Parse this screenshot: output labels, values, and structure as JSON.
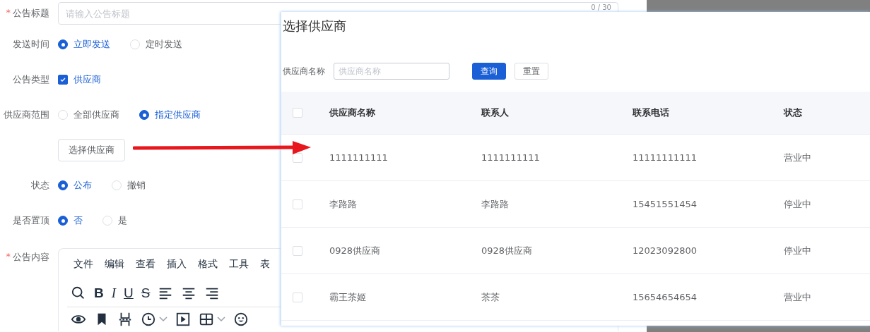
{
  "form": {
    "title_field": {
      "label": "公告标题",
      "required_mark": "*",
      "placeholder": "请输入公告标题",
      "counter": "0 / 30"
    },
    "send_time": {
      "label": "发送时间",
      "options": [
        {
          "label": "立即发送",
          "selected": true
        },
        {
          "label": "定时发送",
          "selected": false
        }
      ]
    },
    "notice_type": {
      "label": "公告类型",
      "options": [
        {
          "label": "供应商",
          "checked": true
        }
      ]
    },
    "supplier_scope": {
      "label": "供应商范围",
      "options": [
        {
          "label": "全部供应商",
          "selected": false
        },
        {
          "label": "指定供应商",
          "selected": true
        }
      ]
    },
    "select_button": "选择供应商",
    "status": {
      "label": "状态",
      "options": [
        {
          "label": "公布",
          "selected": true
        },
        {
          "label": "撤销",
          "selected": false
        }
      ]
    },
    "pinned": {
      "label": "是否置顶",
      "options": [
        {
          "label": "否",
          "selected": true
        },
        {
          "label": "是",
          "selected": false
        }
      ]
    },
    "content": {
      "label": "公告内容",
      "required_mark": "*",
      "menu": [
        "文件",
        "编辑",
        "查看",
        "插入",
        "格式",
        "工具",
        "表"
      ],
      "toolbar_1": [
        {
          "kind": "search"
        },
        {
          "kind": "bold",
          "text": "B"
        },
        {
          "kind": "italic",
          "text": "I"
        },
        {
          "kind": "underline",
          "text": "U"
        },
        {
          "kind": "strike",
          "text": "S"
        },
        {
          "kind": "align-left"
        },
        {
          "kind": "align-center"
        },
        {
          "kind": "align-right"
        }
      ],
      "toolbar_2": [
        {
          "kind": "eye"
        },
        {
          "kind": "bookmark"
        },
        {
          "kind": "page-break"
        },
        {
          "kind": "clock",
          "dropdown": true
        },
        {
          "kind": "media"
        },
        {
          "kind": "table",
          "dropdown": true
        },
        {
          "kind": "emoji"
        }
      ]
    }
  },
  "dialog": {
    "title": "选择供应商",
    "search_label": "供应商名称",
    "search_placeholder": "供应商名称",
    "buttons": [
      {
        "label": "查询",
        "kind": "primary"
      },
      {
        "label": "重置",
        "kind": "default"
      }
    ],
    "table": {
      "header_checked": false,
      "columns": [
        "供应商名称",
        "联系人",
        "联系电话",
        "状态"
      ],
      "rows": [
        {
          "checked": false,
          "cells": [
            "1111111111",
            "1111111111",
            "11111111111",
            "营业中"
          ]
        },
        {
          "checked": false,
          "cells": [
            "李路路",
            "李路路",
            "15451551454",
            "停业中"
          ]
        },
        {
          "checked": false,
          "cells": [
            "0928供应商",
            "0928供应商",
            "12023092800",
            "停业中"
          ]
        },
        {
          "checked": false,
          "cells": [
            "霸王茶姬",
            "茶茶",
            "15654654654",
            "营业中"
          ]
        }
      ]
    }
  }
}
